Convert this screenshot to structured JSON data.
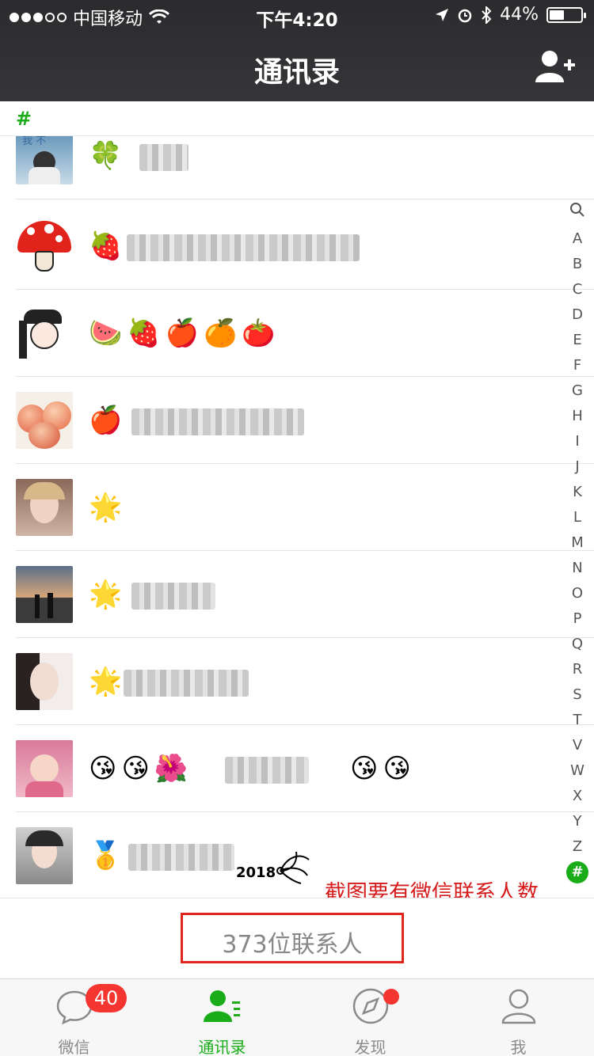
{
  "status_bar": {
    "carrier": "中国移动",
    "time": "下午4:20",
    "battery": "44%",
    "battery_level": 0.44,
    "icons": [
      "signal-dots",
      "wifi-icon",
      "location-icon",
      "alarm-icon",
      "bluetooth-icon",
      "battery-icon"
    ]
  },
  "nav": {
    "title": "通讯录",
    "right_icon": "add-contact-icon"
  },
  "section": {
    "header": "#"
  },
  "contacts": [
    {
      "emoji": "🍀",
      "avatar_text": "我 不",
      "name_hidden": true
    },
    {
      "emoji": "🍓",
      "name_hidden": true
    },
    {
      "emoji": "🍉🍓🍎🍊🍅",
      "name_hidden": false
    },
    {
      "emoji": "🍎",
      "name_hidden": true
    },
    {
      "emoji": "🌟",
      "name_hidden": false
    },
    {
      "emoji": "🌟",
      "name_hidden": true
    },
    {
      "emoji": "🌟",
      "name_hidden": true
    },
    {
      "emoji": "😘😘🌺",
      "name_hidden": true
    },
    {
      "emoji": "🥇",
      "name_hidden": true,
      "tag": "2018"
    }
  ],
  "index_bar": [
    "A",
    "B",
    "C",
    "D",
    "E",
    "F",
    "G",
    "H",
    "I",
    "J",
    "K",
    "L",
    "M",
    "N",
    "O",
    "P",
    "Q",
    "R",
    "S",
    "T",
    "V",
    "W",
    "X",
    "Y",
    "Z",
    "#"
  ],
  "annotation": "截图要有微信联系人数",
  "footer": {
    "contact_count": "373位联系人"
  },
  "tabs": [
    {
      "label": "微信",
      "icon": "chat-bubble-icon",
      "badge": "40",
      "active": false
    },
    {
      "label": "通讯录",
      "icon": "contacts-icon",
      "active": true
    },
    {
      "label": "发现",
      "icon": "compass-icon",
      "dot": true,
      "active": false
    },
    {
      "label": "我",
      "icon": "profile-icon",
      "active": false
    }
  ],
  "colors": {
    "accent": "#1aad19",
    "badge": "#f43530",
    "annotation": "#d51b1b",
    "navbar": "#2e2e31"
  }
}
